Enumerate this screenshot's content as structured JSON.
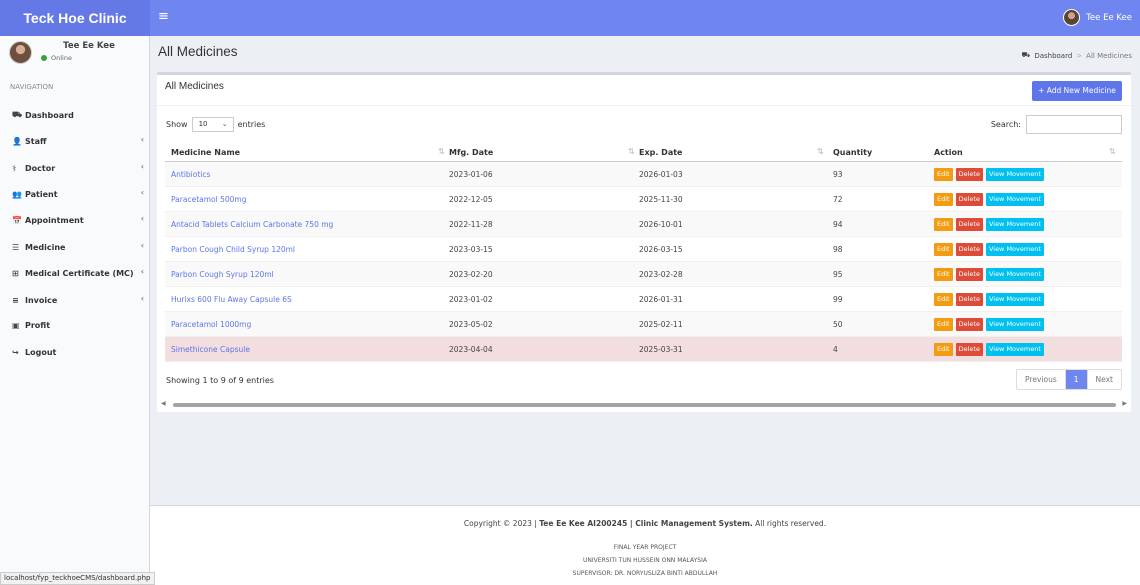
{
  "app": {
    "brand": "Teck Hoe Clinic",
    "menu_icon": "hamburger-icon"
  },
  "top_user": {
    "name": "Tee Ee Kee"
  },
  "sidebar": {
    "user_name": "Tee Ee Kee",
    "status": "Online",
    "nav_header": "NAVIGATION",
    "items": [
      {
        "label": "Dashboard",
        "icon": "dashboard-icon",
        "glyph": "⛟",
        "arrow": false
      },
      {
        "label": "Staff",
        "icon": "user-icon",
        "glyph": "👤",
        "arrow": true
      },
      {
        "label": "Doctor",
        "icon": "doctor-icon",
        "glyph": "⚕",
        "arrow": true
      },
      {
        "label": "Patient",
        "icon": "users-icon",
        "glyph": "👥",
        "arrow": true
      },
      {
        "label": "Appointment",
        "icon": "calendar-icon",
        "glyph": "📅",
        "arrow": true
      },
      {
        "label": "Medicine",
        "icon": "list-icon",
        "glyph": "☰",
        "arrow": true
      },
      {
        "label": "Medical Certificate (MC)",
        "icon": "plus-square-icon",
        "glyph": "⊞",
        "arrow": true
      },
      {
        "label": "Invoice",
        "icon": "bars-icon",
        "glyph": "≡",
        "arrow": true
      },
      {
        "label": "Profit",
        "icon": "money-icon",
        "glyph": "▣",
        "arrow": false
      },
      {
        "label": "Logout",
        "icon": "logout-icon",
        "glyph": "↪",
        "arrow": false
      }
    ]
  },
  "header": {
    "title": "All Medicines",
    "breadcrumb": {
      "home": "Dashboard",
      "sep": ">",
      "current": "All Medicines"
    }
  },
  "box": {
    "title": "All Medicines",
    "add_button": "+ Add New Medicine",
    "show_label": "Show",
    "entries_value": "10",
    "entries_label": "entries",
    "search_label": "Search:",
    "search_value": ""
  },
  "table": {
    "columns": [
      "Medicine Name",
      "Mfg. Date",
      "Exp. Date",
      "Quantity",
      "Action"
    ],
    "rows": [
      [
        "Antibiotics",
        "2023-01-06",
        "2026-01-03",
        "93"
      ],
      [
        "Paracetamol 500mg",
        "2022-12-05",
        "2025-11-30",
        "72"
      ],
      [
        "Antacid Tablets Calcium Carbonate 750 mg",
        "2022-11-28",
        "2026-10-01",
        "94"
      ],
      [
        "Parbon Cough Child Syrup 120ml",
        "2023-03-15",
        "2026-03-15",
        "98"
      ],
      [
        "Parbon Cough Syrup 120ml",
        "2023-02-20",
        "2023-02-28",
        "95"
      ],
      [
        "Hurixs 600 Flu Away Capsule 6S",
        "2023-01-02",
        "2026-01-31",
        "99"
      ],
      [
        "Paracetamol 1000mg",
        "2023-05-02",
        "2025-02-11",
        "50"
      ],
      [
        "Simethicone Capsule",
        "2023-04-04",
        "2025-03-31",
        "4"
      ]
    ],
    "highlight_row": 7,
    "action_labels": {
      "edit": "Edit",
      "delete": "Delete",
      "movement": "View Movement"
    }
  },
  "footer_table": {
    "showing": "Showing 1 to 9 of 9 entries",
    "prev": "Previous",
    "page": "1",
    "next": "Next"
  },
  "footer": {
    "copyright_prefix": "Copyright © 2023 | ",
    "copyright_bold": "Tee Ee Kee AI200245 | Clinic Management System.",
    "copyright_suffix": " All rights reserved.",
    "line1": "FINAL YEAR PROJECT",
    "line2": "UNIVERSITI TUN HUSSEIN ONN MALAYSIA",
    "line3": "SUPERVISOR: DR. NORYUSLIZA BINTI ABDULLAH"
  },
  "status_url": "localhost/fyp_teckhoeCMS/dashboard.php",
  "colors": {
    "primary": "#6f86f0",
    "edit": "#f39c12",
    "delete": "#dd4b39",
    "movement": "#00c0ef",
    "danger_row": "#f2dede"
  }
}
